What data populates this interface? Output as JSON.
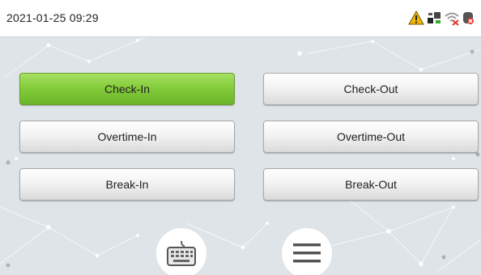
{
  "status_bar": {
    "datetime": "2021-01-25 09:29",
    "icons": [
      "warning-icon",
      "network-icon",
      "wifi-disconnected-icon",
      "cloud-server-error-icon"
    ]
  },
  "buttons": {
    "check_in": "Check-In",
    "check_out": "Check-Out",
    "overtime_in": "Overtime-In",
    "overtime_out": "Overtime-Out",
    "break_in": "Break-In",
    "break_out": "Break-Out"
  },
  "bottom_controls": [
    "keyboard-icon",
    "menu-icon"
  ],
  "colors": {
    "active_button": "#84cc3a",
    "warning": "#f2b400",
    "error": "#d93a2b"
  }
}
